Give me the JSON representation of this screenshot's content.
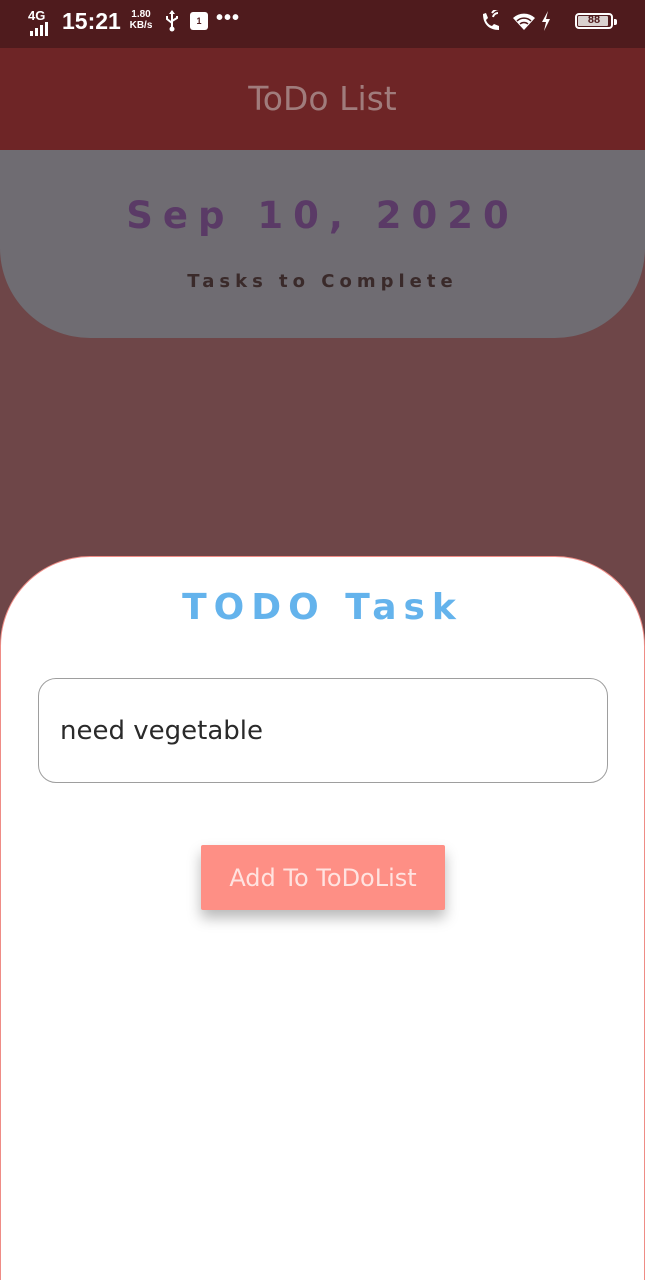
{
  "status_bar": {
    "network_type": "4G",
    "time": "15:21",
    "speed_value": "1.80",
    "speed_unit": "KB/s",
    "sim_icon_text": "1",
    "more_icon": "•••",
    "battery_level": "88",
    "icons": [
      "signal-icon",
      "usb-icon",
      "sim-icon",
      "more-icon",
      "wifi-call-icon",
      "wifi-icon",
      "charging-icon",
      "battery-icon"
    ]
  },
  "app_bar": {
    "title": "ToDo List"
  },
  "header": {
    "date": "Sep 10, 2020",
    "subtitle": "Tasks to Complete"
  },
  "sheet": {
    "title": "TODO Task",
    "input_value": "need vegetable",
    "button_label": "Add To ToDoList"
  },
  "colors": {
    "status_bar": "#4f1b1d",
    "app_bar": "#6e2526",
    "scrim": "#6e4648",
    "header_card": "#6f6c72",
    "date_text": "#5a3a66",
    "sheet_title": "#64b3ec",
    "button": "#fe8f85",
    "sheet_border": "#ef8c86"
  }
}
